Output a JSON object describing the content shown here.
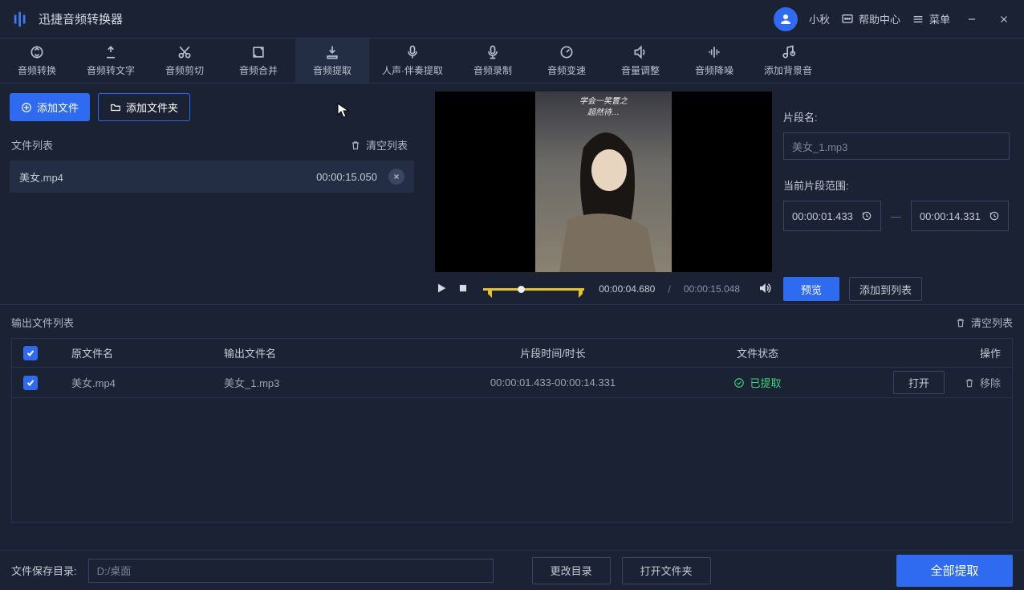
{
  "app": {
    "title": "迅捷音频转换器"
  },
  "titlebar": {
    "username": "小秋",
    "help": "帮助中心",
    "menu": "菜单"
  },
  "nav": [
    {
      "label": "音频转换",
      "icon": "convert"
    },
    {
      "label": "音频转文字",
      "icon": "to-text"
    },
    {
      "label": "音频剪切",
      "icon": "cut"
    },
    {
      "label": "音频合并",
      "icon": "merge"
    },
    {
      "label": "音频提取",
      "icon": "extract",
      "active": true
    },
    {
      "label": "人声·伴奏提取",
      "icon": "vocal",
      "wide": true
    },
    {
      "label": "音频录制",
      "icon": "record"
    },
    {
      "label": "音频变速",
      "icon": "speed"
    },
    {
      "label": "音量调整",
      "icon": "volume"
    },
    {
      "label": "音频降噪",
      "icon": "denoise"
    },
    {
      "label": "添加背景音",
      "icon": "bgm"
    }
  ],
  "buttons": {
    "add_file": "添加文件",
    "add_folder": "添加文件夹",
    "preview": "预览",
    "add_to_list": "添加到列表",
    "open": "打开",
    "remove": "移除",
    "change_dir": "更改目录",
    "open_folder": "打开文件夹",
    "extract_all": "全部提取"
  },
  "labels": {
    "file_list": "文件列表",
    "clear_list": "清空列表",
    "output_list": "输出文件列表",
    "clip_name": "片段名:",
    "range": "当前片段范围:",
    "save_dir": "文件保存目录:",
    "col_src": "原文件名",
    "col_out": "输出文件名",
    "col_time": "片段时间/时长",
    "col_state": "文件状态",
    "col_act": "操作"
  },
  "file": {
    "name": "美女.mp4",
    "duration": "00:00:15.050"
  },
  "player": {
    "current": "00:00:04.680",
    "total": "00:00:15.048"
  },
  "clip": {
    "name_value": "美女_1.mp3",
    "start": "00:00:01.433",
    "end": "00:00:14.331"
  },
  "output_row": {
    "src": "美女.mp4",
    "out": "美女_1.mp3",
    "time": "00:00:01.433-00:00:14.331",
    "state": "已提取"
  },
  "footer": {
    "path": "D:/桌面"
  },
  "video_subtitle1": "学会一笑置之",
  "video_subtitle2": "超然待…"
}
